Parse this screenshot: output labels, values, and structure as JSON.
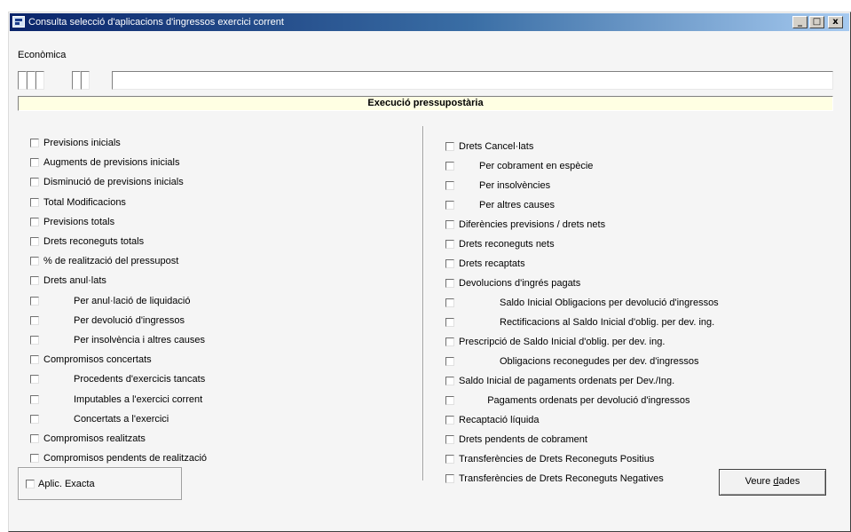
{
  "window": {
    "title": "Consulta selecció d'aplicacions d'ingressos exercici corrent",
    "min_glyph": "_",
    "max_glyph": "□",
    "close_glyph": "x"
  },
  "economica": {
    "label": "Econòmica",
    "description_value": ""
  },
  "banner": {
    "title": "Execució pressupostària"
  },
  "left_items": [
    {
      "label": "Previsions inicials",
      "indent": false
    },
    {
      "label": "Augments de previsions inicials",
      "indent": false
    },
    {
      "label": "Disminució de previsions inicials",
      "indent": false
    },
    {
      "label": "Total Modificacions",
      "indent": false
    },
    {
      "label": "Previsions totals",
      "indent": false
    },
    {
      "label": "Drets reconeguts totals",
      "indent": false
    },
    {
      "label": "% de realització del pressupost",
      "indent": false
    },
    {
      "label": "Drets anul·lats",
      "indent": false
    },
    {
      "label": "Per anul·lació de liquidació",
      "indent": true
    },
    {
      "label": "Per devolució d'ingressos",
      "indent": true
    },
    {
      "label": "Per insolvència i altres causes",
      "indent": true
    },
    {
      "label": "Compromisos concertats",
      "indent": false
    },
    {
      "label": "Procedents d'exercicis tancats",
      "indent": true
    },
    {
      "label": "Imputables a l'exercici corrent",
      "indent": true
    },
    {
      "label": "Concertats a l'exercici",
      "indent": true
    },
    {
      "label": "Compromisos realitzats",
      "indent": false
    },
    {
      "label": "Compromisos pendents de realització",
      "indent": false
    }
  ],
  "right_items": [
    {
      "label": "Drets Cancel·lats",
      "indent": 0
    },
    {
      "label": "Per cobrament en espècie",
      "indent": 1
    },
    {
      "label": "Per insolvències",
      "indent": 1
    },
    {
      "label": "Per altres causes",
      "indent": 1
    },
    {
      "label": "Diferències previsions / drets nets",
      "indent": 0
    },
    {
      "label": "Drets reconeguts nets",
      "indent": 0
    },
    {
      "label": "Drets recaptats",
      "indent": 0
    },
    {
      "label": "Devolucions d'ingrés pagats",
      "indent": 0
    },
    {
      "label": "Saldo Inicial Obligacions per devolució d'ingressos",
      "indent": 2
    },
    {
      "label": "Rectificacions al Saldo Inicial d'oblig. per dev. ing.",
      "indent": 2
    },
    {
      "label": "Prescripció de Saldo Inicial d'oblig. per dev. ing.",
      "indent": 0
    },
    {
      "label": "Obligacions reconegudes per dev. d'ingressos",
      "indent": 2
    },
    {
      "label": "Saldo Inicial de pagaments ordenats per Dev./Ing.",
      "indent": 0
    },
    {
      "label": "Pagaments ordenats per devolució d'ingressos",
      "indent": 1.4
    },
    {
      "label": "Recaptació líquida",
      "indent": 0
    },
    {
      "label": "Drets pendents de cobrament",
      "indent": 0
    },
    {
      "label": "Transferències de Drets Reconeguts Positius",
      "indent": 0
    },
    {
      "label": "Transferències de Drets Reconeguts Negatives",
      "indent": 0
    }
  ],
  "aplic_exacta": {
    "label": "Aplic. Exacta"
  },
  "veure_button": {
    "label_pre": "Veure ",
    "label_accel": "d",
    "label_post": "ades"
  }
}
